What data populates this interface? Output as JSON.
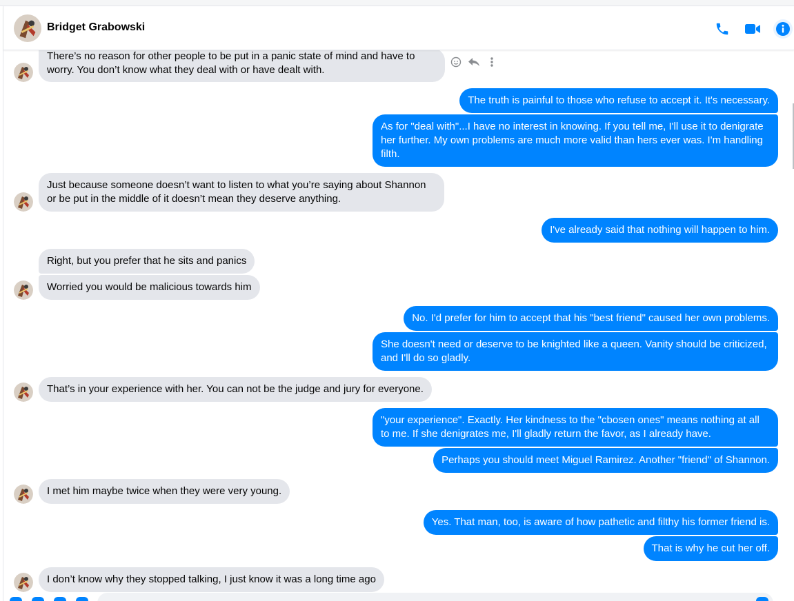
{
  "header": {
    "contact_name": "Bridget Grabowski",
    "icons": [
      "phone-icon",
      "video-camera-icon",
      "info-icon"
    ],
    "accent_color": "#0084ff"
  },
  "messages": [
    {
      "side": "in",
      "text": "There’s no reason for other people to be put in a panic state of mind and have to worry. You don’t know what they deal with or have dealt with."
    },
    {
      "side": "out",
      "text": "The truth is painful to those who refuse to accept it. It's necessary."
    },
    {
      "side": "out",
      "text": "As for \"deal with\"...I have no interest in knowing. If you tell me, I'll use it to denigrate her further. My own problems are much more valid than hers ever was. I'm handling filth."
    },
    {
      "side": "in",
      "text": "Just because someone doesn’t want to listen to what you’re saying about Shannon or be put in the middle of it doesn’t mean they deserve anything."
    },
    {
      "side": "out",
      "text": "I've already said that nothing will happen to him."
    },
    {
      "side": "in",
      "text": "Right, but you prefer that he sits and panics"
    },
    {
      "side": "in",
      "text": "Worried you would be malicious towards him"
    },
    {
      "side": "out",
      "text": "No. I'd prefer for him to accept that his \"best friend\" caused her own problems."
    },
    {
      "side": "out",
      "text": "She doesn't need or deserve to be knighted like a queen. Vanity should be criticized, and I'll do so gladly."
    },
    {
      "side": "in",
      "text": "That’s in your experience with her. You can not be the judge and jury for everyone."
    },
    {
      "side": "out",
      "text": "\"your experience\". Exactly. Her kindness to the \"cbosen ones\" means nothing at all to me. If she denigrates me, I'll gladly return the favor, as I already have."
    },
    {
      "side": "out",
      "text": "Perhaps you should meet Miguel Ramirez. Another \"friend\" of Shannon."
    },
    {
      "side": "in",
      "text": "I met him maybe twice when they were very young."
    },
    {
      "side": "out",
      "text": "Yes. That man, too, is aware of how pathetic and filthy his former friend is."
    },
    {
      "side": "out",
      "text": "That is why he cut her off."
    },
    {
      "side": "in",
      "text": "I don’t know why they stopped talking, I just know it was a long time ago"
    }
  ],
  "hover_actions": [
    "emoji-react-icon",
    "reply-icon",
    "more-options-icon"
  ],
  "colors": {
    "incoming_bubble": "#e4e6eb",
    "outgoing_bubble": "#0084ff"
  }
}
